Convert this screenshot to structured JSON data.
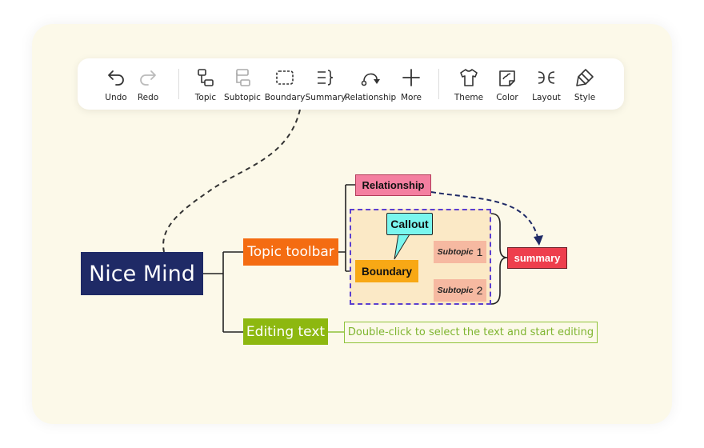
{
  "toolbar": {
    "undo": "Undo",
    "redo": "Redo",
    "topic": "Topic",
    "subtopic": "Subtopic",
    "boundary": "Boundary",
    "summary": "Summary",
    "relationship": "Relationship",
    "more": "More",
    "theme": "Theme",
    "color": "Color",
    "layout": "Layout",
    "style": "Style"
  },
  "mindmap": {
    "root": "Nice Mind",
    "topic_toolbar": "Topic toolbar",
    "editing_text": "Editing text",
    "editing_note": "Double-click to select the text and start editing",
    "relationship": "Relationship",
    "callout": "Callout",
    "boundary": "Boundary",
    "subtopic1_word": "Subtopic",
    "subtopic1_num": "1",
    "subtopic2_word": "Subtopic",
    "subtopic2_num": "2",
    "summary": "summary"
  },
  "colors": {
    "root": "#1f2a66",
    "topic_toolbar": "#f46c12",
    "editing_text": "#8db810",
    "relationship": "#f47fa0",
    "callout": "#7af6ee",
    "boundary": "#f8a815",
    "subtopic": "#f6b9a1",
    "summary": "#ee3e4d",
    "boundary_frame": "#5b3fd0"
  }
}
